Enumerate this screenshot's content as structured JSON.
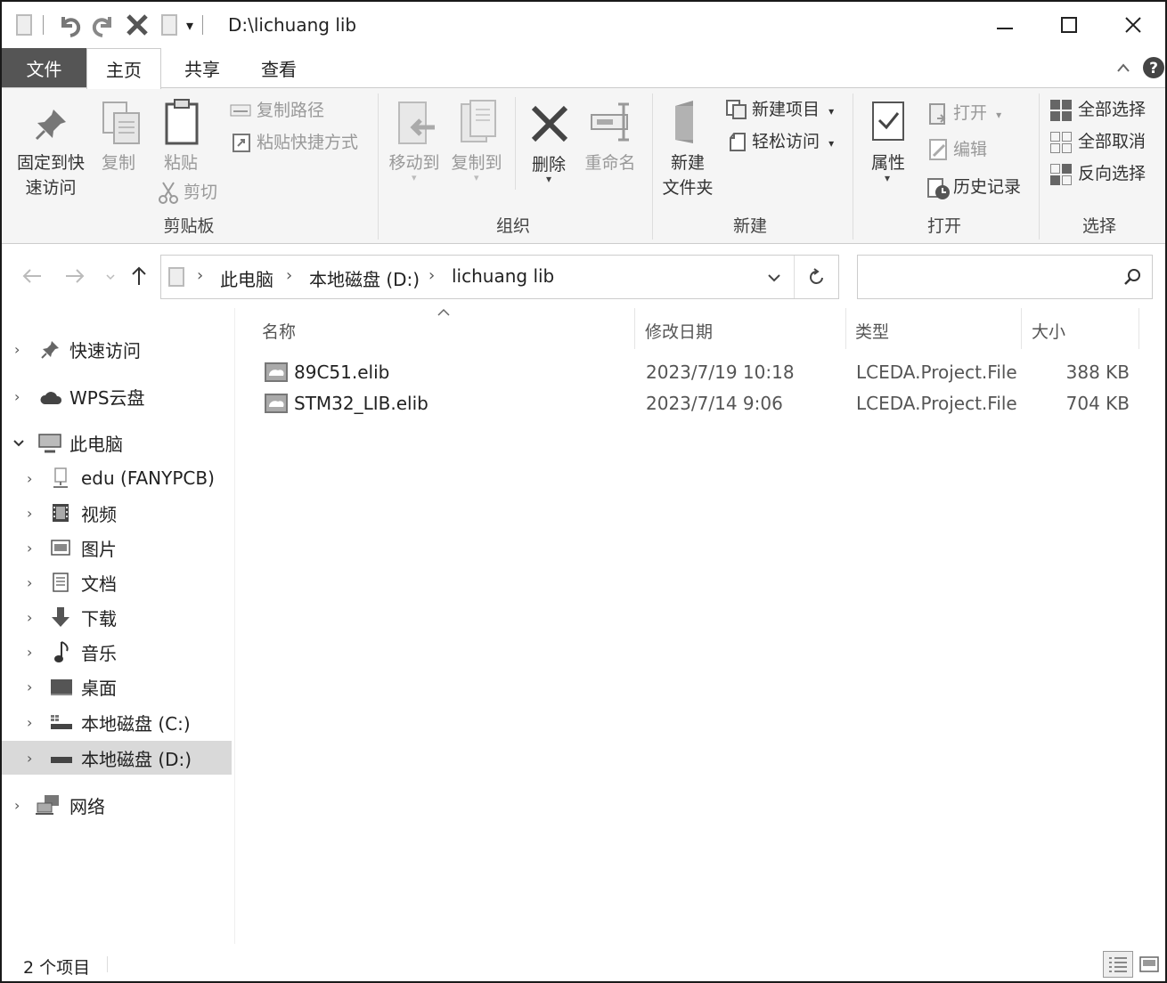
{
  "window": {
    "title": "D:\\lichuang lib",
    "min_icon": "minimize-icon",
    "max_icon": "maximize-icon",
    "close_icon": "close-icon"
  },
  "quick_access": {
    "dropdown": "▾"
  },
  "tabs": {
    "file": "文件",
    "home": "主页",
    "share": "共享",
    "view": "查看"
  },
  "ribbon": {
    "clipboard": {
      "pin": [
        "固定到快",
        "速访问"
      ],
      "copy": "复制",
      "paste": "粘贴",
      "copy_path": "复制路径",
      "paste_shortcut": "粘贴快捷方式",
      "cut": "剪切",
      "label": "剪贴板"
    },
    "organize": {
      "move_to": "移动到",
      "copy_to": "复制到",
      "delete": "删除",
      "rename": "重命名",
      "label": "组织"
    },
    "new": {
      "new_folder": [
        "新建",
        "文件夹"
      ],
      "new_item": "新建项目",
      "easy_access": "轻松访问",
      "label": "新建"
    },
    "open": {
      "properties": "属性",
      "open": "打开",
      "edit": "编辑",
      "history": "历史记录",
      "label": "打开"
    },
    "select": {
      "select_all": "全部选择",
      "select_none": "全部取消",
      "invert": "反向选择",
      "label": "选择"
    }
  },
  "address": {
    "crumbs": [
      "此电脑",
      "本地磁盘 (D:)",
      "lichuang lib"
    ],
    "search_placeholder": ""
  },
  "nav": {
    "quick_access": "快速访问",
    "wps": "WPS云盘",
    "this_pc": "此电脑",
    "items": [
      "edu (FANYPCB)",
      "视频",
      "图片",
      "文档",
      "下载",
      "音乐",
      "桌面",
      "本地磁盘 (C:)",
      "本地磁盘 (D:)"
    ],
    "network": "网络"
  },
  "columns": {
    "name": "名称",
    "date": "修改日期",
    "type": "类型",
    "size": "大小"
  },
  "files": [
    {
      "name": "89C51.elib",
      "date": "2023/7/19 10:18",
      "type": "LCEDA.Project.File",
      "size": "388 KB"
    },
    {
      "name": "STM32_LIB.elib",
      "date": "2023/7/14 9:06",
      "type": "LCEDA.Project.File",
      "size": "704 KB"
    }
  ],
  "status": {
    "count": "2 个项目"
  }
}
